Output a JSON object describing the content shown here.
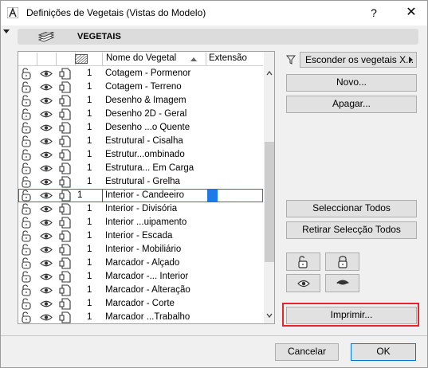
{
  "window": {
    "title": "Definições de Vegetais (Vistas do Modelo)",
    "help_label": "?",
    "close_label": "✕"
  },
  "section": {
    "title": "VEGETAIS"
  },
  "list": {
    "header": {
      "name": "Nome do Vegetal",
      "extension": "Extensão"
    },
    "rows": [
      {
        "pen": "1",
        "name": "Cotagem - Pormenor"
      },
      {
        "pen": "1",
        "name": "Cotagem - Terreno"
      },
      {
        "pen": "1",
        "name": "Desenho & Imagem"
      },
      {
        "pen": "1",
        "name": "Desenho 2D - Geral"
      },
      {
        "pen": "1",
        "name": "Desenho ...o Quente"
      },
      {
        "pen": "1",
        "name": "Estrutural - Cisalha"
      },
      {
        "pen": "1",
        "name": "Estrutur...ombinado"
      },
      {
        "pen": "1",
        "name": "Estrutura... Em Carga"
      },
      {
        "pen": "1",
        "name": "Estrutural - Grelha"
      },
      {
        "pen": "1",
        "name": "Interior - Candeeiro",
        "selected": true
      },
      {
        "pen": "1",
        "name": "Interior - Divisória"
      },
      {
        "pen": "1",
        "name": "Interior ...uipamento"
      },
      {
        "pen": "1",
        "name": "Interior - Escada"
      },
      {
        "pen": "1",
        "name": "Interior - Mobiliário"
      },
      {
        "pen": "1",
        "name": "Marcador - Alçado"
      },
      {
        "pen": "1",
        "name": "Marcador -... Interior"
      },
      {
        "pen": "1",
        "name": "Marcador - Alteração"
      },
      {
        "pen": "1",
        "name": "Marcador - Corte"
      },
      {
        "pen": "1",
        "name": "Marcador ...Trabalho"
      }
    ]
  },
  "filter": {
    "value": "Esconder os vegetais X..."
  },
  "buttons": {
    "new": "Novo...",
    "delete": "Apagar...",
    "select_all": "Seleccionar Todos",
    "deselect_all": "Retirar Selecção Todos",
    "print": "Imprimir...",
    "cancel": "Cancelar",
    "ok": "OK"
  },
  "colors": {
    "focus_ring": "#e8232a",
    "selection": "#1e7ae6",
    "header_bar": "#dcdcdc"
  }
}
